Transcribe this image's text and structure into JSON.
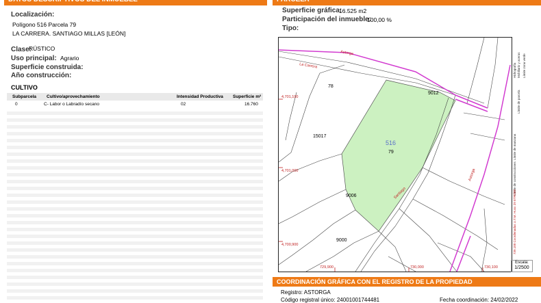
{
  "left": {
    "header": "DATOS DESCRIPTIVOS DEL INMUEBLE",
    "localizacion_label": "Localización:",
    "localizacion_line1": "Polígono 516 Parcela 79",
    "localizacion_line2": "LA CARRERA. SANTIAGO MILLAS [LEÓN]",
    "clase_label": "Clase:",
    "clase_value": "RÚSTICO",
    "uso_label": "Uso principal:",
    "uso_value": "Agrario",
    "sup_construida_label": "Superficie construida:",
    "anio_label": "Año construcción:",
    "cultivo_title": "CULTIVO",
    "table": {
      "headers": [
        "Subparcela",
        "Cultivo/aprovechamiento",
        "Intensidad Productiva",
        "Superficie m²"
      ],
      "rows": [
        [
          "0",
          "C- Labor o Labradío secano",
          "02",
          "16.760"
        ]
      ]
    }
  },
  "right": {
    "header": "PARCELA",
    "sup_grafica_label": "Superficie gráfica:",
    "sup_grafica_value": "16.525 m2",
    "participacion_label": "Participación del inmueble:",
    "participacion_value": "100,00 %",
    "tipo_label": "Tipo:",
    "map": {
      "parcel_number": "516",
      "parcel_sub": "79",
      "labels": {
        "n78": "78",
        "n9012": "9012",
        "n15017": "15017",
        "n9006": "9006",
        "n9000": "9000",
        "y1": "4,701,100",
        "y2": "4,701,000",
        "y3": "4,700,900",
        "x1": "729,900",
        "x2": "730,000",
        "x3": "730,100",
        "road1": "La Carrera",
        "road2": "Astorga",
        "road3": "Astorga",
        "road4": "Santiago"
      }
    },
    "legend": [
      "Límite de manzana",
      "Límite de parcela",
      "Límite de construcciones",
      "Mobiliario y aceras",
      "Límite zona verde",
      "Hidrografía"
    ],
    "legend_note": "739.100 Coordenadas U.T.M. Huso 29 ETRS89",
    "scale_label": "Escala:",
    "scale_value": "1/2500",
    "coord_header": "COORDINACIÓN GRÁFICA CON EL REGISTRO DE LA PROPIEDAD",
    "registro_label": "Registro:",
    "registro_value": "ASTORGA",
    "codigo_label": "Código registral único:",
    "codigo_value": "24001001744481",
    "fecha_label": "Fecha coordinación:",
    "fecha_value": "24/02/2022"
  }
}
